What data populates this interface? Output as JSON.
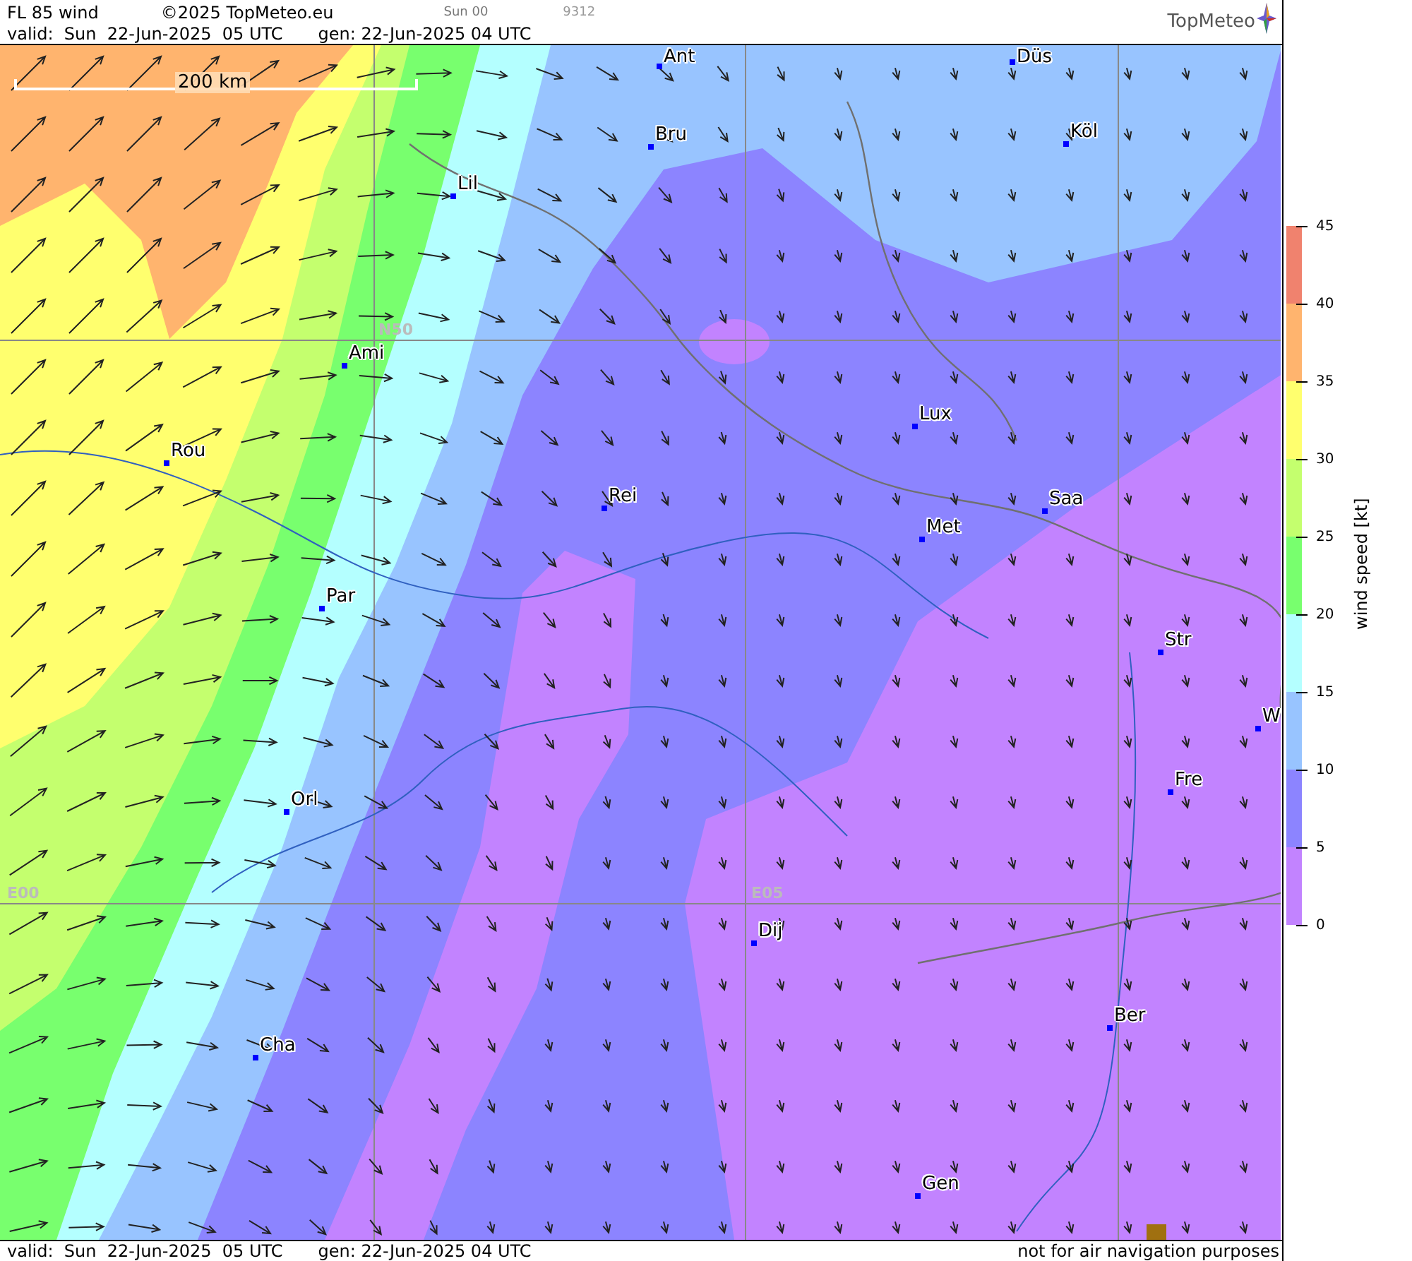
{
  "header": {
    "title": "FL 85 wind",
    "copyright": "©2025 TopMeteo.eu",
    "run": "Sun 00",
    "code": "9312",
    "valid": "valid:  Sun  22-Jun-2025  05 UTC",
    "generated": "gen: 22-Jun-2025 04 UTC",
    "logo": "TopMeteo"
  },
  "map": {
    "scale_bar": "200 km",
    "grid_labels": [
      {
        "text": "N50"
      },
      {
        "text": "E00"
      },
      {
        "text": "E05"
      }
    ],
    "cities": [
      {
        "name": "Ant"
      },
      {
        "name": "Düs"
      },
      {
        "name": "Bru"
      },
      {
        "name": "Köl"
      },
      {
        "name": "Lil"
      },
      {
        "name": "Ami"
      },
      {
        "name": "Rou"
      },
      {
        "name": "Lux"
      },
      {
        "name": "Rei"
      },
      {
        "name": "Saa"
      },
      {
        "name": "Met"
      },
      {
        "name": "Par"
      },
      {
        "name": "Str"
      },
      {
        "name": "W"
      },
      {
        "name": "Fre"
      },
      {
        "name": "Orl"
      },
      {
        "name": "Dij"
      },
      {
        "name": "Ber"
      },
      {
        "name": "Cha"
      },
      {
        "name": "Gen"
      }
    ]
  },
  "legend": {
    "title": "wind speed [kt]",
    "bands": [
      {
        "color": "#f0826e"
      },
      {
        "color": "#ffb46e"
      },
      {
        "color": "#ffff6e"
      },
      {
        "color": "#c4ff6e"
      },
      {
        "color": "#78ff6e"
      },
      {
        "color": "#b4ffff"
      },
      {
        "color": "#98c4ff"
      },
      {
        "color": "#8c84ff"
      },
      {
        "color": "#c283ff"
      }
    ],
    "ticks": [
      "45",
      "40",
      "35",
      "30",
      "25",
      "20",
      "15",
      "10",
      "5",
      "0"
    ]
  },
  "footer": {
    "valid": "valid:  Sun  22-Jun-2025  05 UTC",
    "generated": "gen: 22-Jun-2025 04 UTC",
    "notice": "not for air navigation purposes"
  }
}
